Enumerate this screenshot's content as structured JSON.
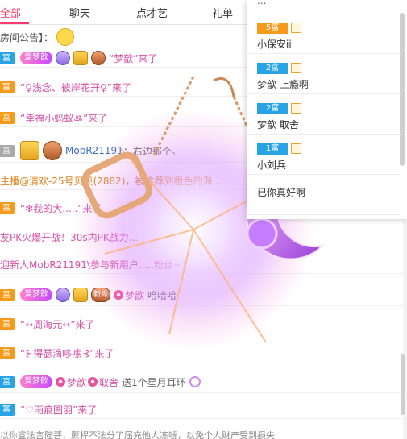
{
  "tabs": [
    {
      "label": "全部",
      "active": true
    },
    {
      "label": "聊天",
      "active": false
    },
    {
      "label": "点才艺",
      "active": false
    },
    {
      "label": "礼单",
      "active": false
    }
  ],
  "colors": {
    "accent": "#ff3a6e",
    "fu_badge": "#f59a1a",
    "rank_blue": "#27a3e6"
  },
  "chat": {
    "announcement": "房间公告】：",
    "rows": [
      {
        "badge": "富",
        "pill": "爱梦歆",
        "text": "“梦歆”来了"
      },
      {
        "badge": "富",
        "text": "“♀浅念、彼岸花开♀”来了"
      },
      {
        "badge": "富",
        "text": "“幸福小蚂蚁ꔛ”来了"
      },
      {
        "badge": "富",
        "name": "MobR21191",
        "text": "：右边那个。"
      },
      {
        "text": "主播@清欢-25号贝贝(2882)，被推荐到橙色的海..."
      },
      {
        "badge": "富",
        "text": "“✻我的大.....”来了"
      },
      {
        "text": "友PK火爆开战！30s内PK战力..."
      },
      {
        "text": "迎新人MobR21191\\参与新用户.....粉丝+1"
      },
      {
        "badge": "富",
        "pill": "爱梦歆",
        "medal_text": "新秀",
        "name": "梦歆",
        "text": "哈哈哈"
      },
      {
        "badge": "富",
        "text": "“↔周海元↔”来了"
      },
      {
        "badge": "富",
        "text": "“⊱得瑟滴哆嗦⊰”来了"
      },
      {
        "badge": "富",
        "pill": "爱梦歆",
        "name": "梦歆",
        "target": "取舍",
        "text": "送1个星月耳环"
      },
      {
        "badge": "富",
        "text": "“♡雨痕圄羽”来了"
      }
    ],
    "footer_note": "以你宣法言陛菩，蔗桿不法分了届充他人冻唬，以免个人财产受到损失"
  },
  "panel": {
    "top_text": "...",
    "items": [
      {
        "rank": "5富",
        "name": "小保安ii"
      },
      {
        "rank": "2富",
        "name": "梦歆  上瘾啊"
      },
      {
        "rank": "2富",
        "name": "梦歆  取舍"
      },
      {
        "rank": "1富",
        "name": "小刘兵"
      },
      {
        "rank": "",
        "name": "已你真好啊"
      }
    ]
  }
}
